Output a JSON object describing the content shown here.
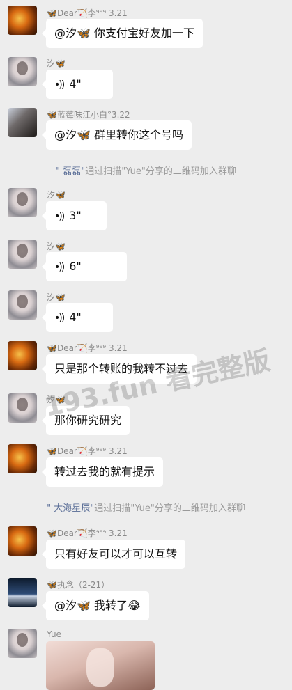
{
  "messages": [
    {
      "kind": "text",
      "avatar": "fire",
      "sender": "🦋Dear🏹李⁹⁹⁹ 3.21",
      "text": "@汐🦋 你支付宝好友加一下"
    },
    {
      "kind": "voice",
      "avatar": "girl",
      "sender": "汐🦋",
      "text": "4\""
    },
    {
      "kind": "text",
      "avatar": "dark",
      "sender": "🦋蓝莓味江小白°3.22",
      "text": "@汐🦋 群里转你这个号吗"
    },
    {
      "kind": "system",
      "who": "\" 磊磊\"",
      "rest": "通过扫描\"Yue\"分享的二维码加入群聊"
    },
    {
      "kind": "voice",
      "avatar": "girl",
      "sender": "汐🦋",
      "text": "3\""
    },
    {
      "kind": "voice",
      "avatar": "girl",
      "sender": "汐🦋",
      "text": "6\""
    },
    {
      "kind": "voice",
      "avatar": "girl",
      "sender": "汐🦋",
      "text": "4\""
    },
    {
      "kind": "text",
      "avatar": "fire",
      "sender": "🦋Dear🏹李⁹⁹⁹ 3.21",
      "text": "只是那个转账的我转不过去"
    },
    {
      "kind": "text",
      "avatar": "girl",
      "sender": "汐🦋",
      "text": "那你研究研究"
    },
    {
      "kind": "text",
      "avatar": "fire",
      "sender": "🦋Dear🏹李⁹⁹⁹ 3.21",
      "text": "转过去我的就有提示"
    },
    {
      "kind": "system",
      "who": "\" 大海星辰\"",
      "rest": "通过扫描\"Yue\"分享的二维码加入群聊"
    },
    {
      "kind": "text",
      "avatar": "fire",
      "sender": "🦋Dear🏹李⁹⁹⁹ 3.21",
      "text": "只有好友可以才可以互转"
    },
    {
      "kind": "text",
      "avatar": "sea",
      "sender": "🦋执念（2-21）",
      "text": "@汐🦋 我转了😂"
    },
    {
      "kind": "image",
      "avatar": "girl",
      "sender": "Yue"
    }
  ],
  "watermark": "193.fun 看完整版",
  "voice_icon": "voice-wave-icon"
}
